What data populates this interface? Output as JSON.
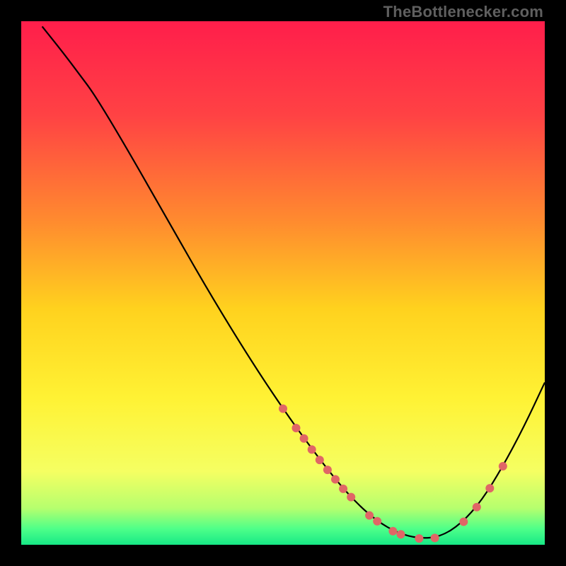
{
  "watermark": "TheBottlenecker.com",
  "chart_data": {
    "type": "line",
    "title": "",
    "xlabel": "",
    "ylabel": "",
    "xlim": [
      0,
      100
    ],
    "ylim": [
      0,
      100
    ],
    "background_gradient": {
      "stops": [
        {
          "pct": 0,
          "color": "#ff1e4b"
        },
        {
          "pct": 18,
          "color": "#ff4244"
        },
        {
          "pct": 38,
          "color": "#ff8a2f"
        },
        {
          "pct": 55,
          "color": "#ffd21e"
        },
        {
          "pct": 72,
          "color": "#fff234"
        },
        {
          "pct": 86,
          "color": "#f5ff62"
        },
        {
          "pct": 93,
          "color": "#b6ff6e"
        },
        {
          "pct": 97,
          "color": "#4dff89"
        },
        {
          "pct": 100,
          "color": "#17e886"
        }
      ]
    },
    "series": [
      {
        "name": "bottleneck-curve",
        "color": "#000000",
        "width": 2.2,
        "points": [
          {
            "x": 4.0,
            "y": 99.0
          },
          {
            "x": 8.0,
            "y": 94.0
          },
          {
            "x": 11.0,
            "y": 90.0
          },
          {
            "x": 14.0,
            "y": 86.0
          },
          {
            "x": 20.0,
            "y": 76.0
          },
          {
            "x": 28.0,
            "y": 62.0
          },
          {
            "x": 36.0,
            "y": 48.0
          },
          {
            "x": 44.0,
            "y": 35.0
          },
          {
            "x": 50.0,
            "y": 26.0
          },
          {
            "x": 55.0,
            "y": 19.0
          },
          {
            "x": 60.0,
            "y": 12.5
          },
          {
            "x": 64.0,
            "y": 8.0
          },
          {
            "x": 68.0,
            "y": 4.5
          },
          {
            "x": 72.0,
            "y": 2.2
          },
          {
            "x": 76.0,
            "y": 1.2
          },
          {
            "x": 80.0,
            "y": 1.5
          },
          {
            "x": 84.0,
            "y": 4.0
          },
          {
            "x": 88.0,
            "y": 8.5
          },
          {
            "x": 92.0,
            "y": 15.0
          },
          {
            "x": 96.0,
            "y": 22.5
          },
          {
            "x": 100.0,
            "y": 31.0
          }
        ]
      }
    ],
    "markers": {
      "color": "#e06666",
      "radius": 6,
      "points": [
        {
          "x": 50.0,
          "y": 26.0
        },
        {
          "x": 52.5,
          "y": 22.3
        },
        {
          "x": 54.0,
          "y": 20.3
        },
        {
          "x": 55.5,
          "y": 18.2
        },
        {
          "x": 57.0,
          "y": 16.2
        },
        {
          "x": 58.5,
          "y": 14.3
        },
        {
          "x": 60.0,
          "y": 12.5
        },
        {
          "x": 61.5,
          "y": 10.7
        },
        {
          "x": 63.0,
          "y": 9.1
        },
        {
          "x": 66.5,
          "y": 5.6
        },
        {
          "x": 68.0,
          "y": 4.5
        },
        {
          "x": 71.0,
          "y": 2.6
        },
        {
          "x": 72.5,
          "y": 2.0
        },
        {
          "x": 76.0,
          "y": 1.2
        },
        {
          "x": 79.0,
          "y": 1.3
        },
        {
          "x": 84.5,
          "y": 4.4
        },
        {
          "x": 87.0,
          "y": 7.2
        },
        {
          "x": 89.5,
          "y": 10.8
        },
        {
          "x": 92.0,
          "y": 15.0
        }
      ]
    }
  }
}
